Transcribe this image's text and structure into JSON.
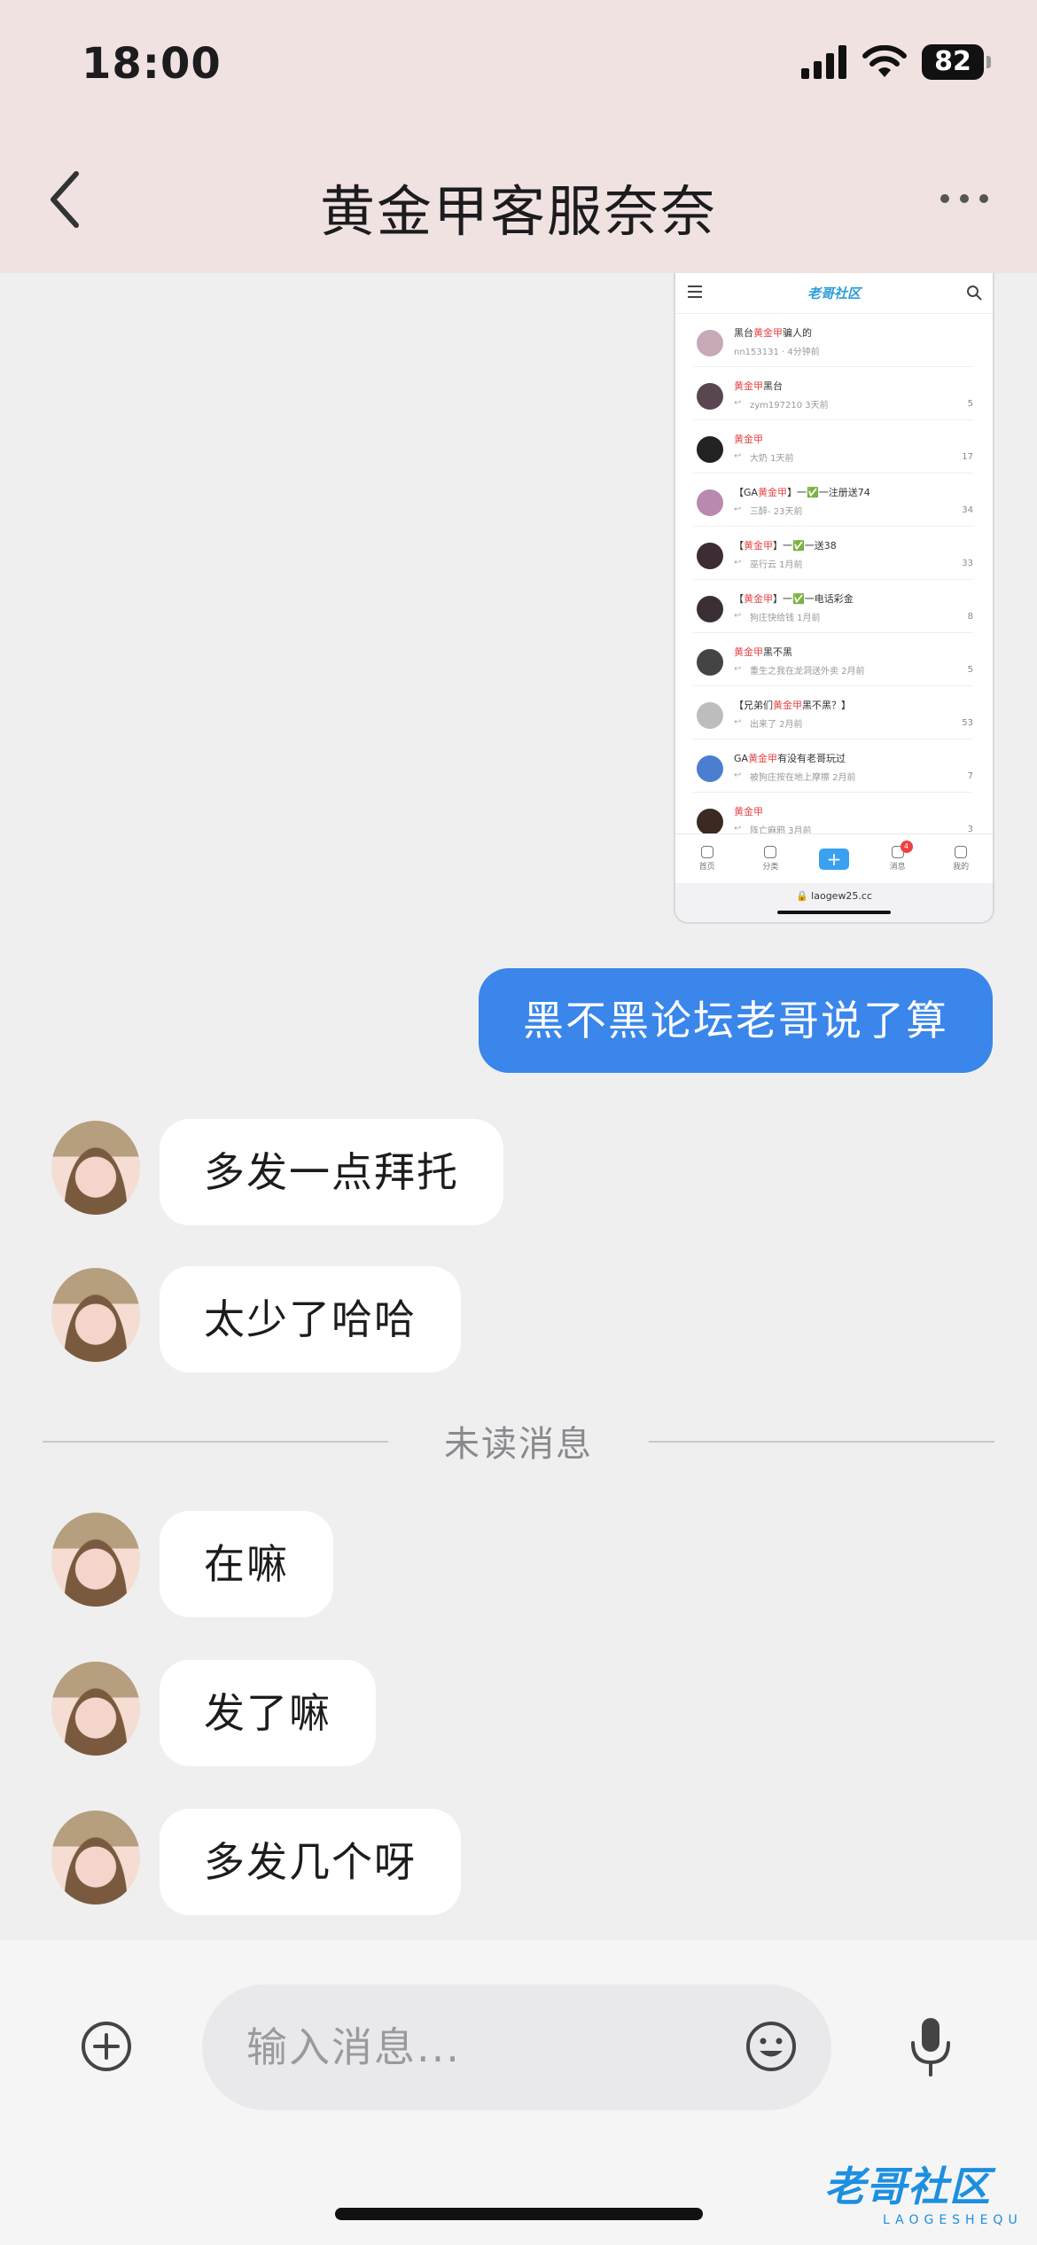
{
  "status_bar": {
    "time": "18:00",
    "battery": "82"
  },
  "header": {
    "title": "黄金甲客服奈奈"
  },
  "shared_screenshot": {
    "logo": "老哥社区",
    "posts": [
      {
        "title": "黑台黄金甲骗人的",
        "meta": "nn153131 · 4分钟前",
        "count": "",
        "avatar_color": "#c8a9b8"
      },
      {
        "title": "黄金甲黑台",
        "meta": "zym197210  3天前",
        "count": "5",
        "avatar_color": "#5a4650"
      },
      {
        "title": "黄金甲",
        "meta": "大奶  1天前",
        "count": "17",
        "avatar_color": "#222222"
      },
      {
        "title": "【GA黄金甲】一✅一注册送74",
        "meta": "三醉-  23天前",
        "count": "34",
        "avatar_color": "#b98ab0"
      },
      {
        "title": "【黄金甲】一✅一送38",
        "meta": "巫行云  1月前",
        "count": "33",
        "avatar_color": "#3d2c33"
      },
      {
        "title": "【黄金甲】一✅一电话彩金",
        "meta": "狗庄快给钱  1月前",
        "count": "8",
        "avatar_color": "#3a2f34"
      },
      {
        "title": "黄金甲黑不黑",
        "meta": "重生之我在龙洞送外卖  2月前",
        "count": "5",
        "avatar_color": "#444444"
      },
      {
        "title": "【兄弟们黄金甲黑不黑？】",
        "meta": "出来了  2月前",
        "count": "53",
        "avatar_color": "#bdbdbd"
      },
      {
        "title": "GA黄金甲有没有老哥玩过",
        "meta": "被狗庄按在地上摩擦  2月前",
        "count": "7",
        "avatar_color": "#4a7fd0"
      },
      {
        "title": "黄金甲",
        "meta": "阵亡麻鸦  3月前",
        "count": "3",
        "avatar_color": "#3a2a22"
      }
    ],
    "tabs": [
      {
        "label": "首页"
      },
      {
        "label": "分类"
      },
      {
        "label": "+"
      },
      {
        "label": "消息",
        "badge": "4"
      },
      {
        "label": "我的"
      }
    ],
    "url": "🔒 laogew25.cc"
  },
  "messages": {
    "me": "黑不黑论坛老哥说了算",
    "them_before": [
      "多发一点拜托",
      "太少了哈哈"
    ],
    "unread_label": "未读消息",
    "them_after": [
      "在嘛",
      "发了嘛",
      "多发几个呀"
    ]
  },
  "input": {
    "placeholder": "输入消息..."
  },
  "watermark": {
    "text": "老哥社区",
    "sub": "LAOGESHEQU"
  }
}
